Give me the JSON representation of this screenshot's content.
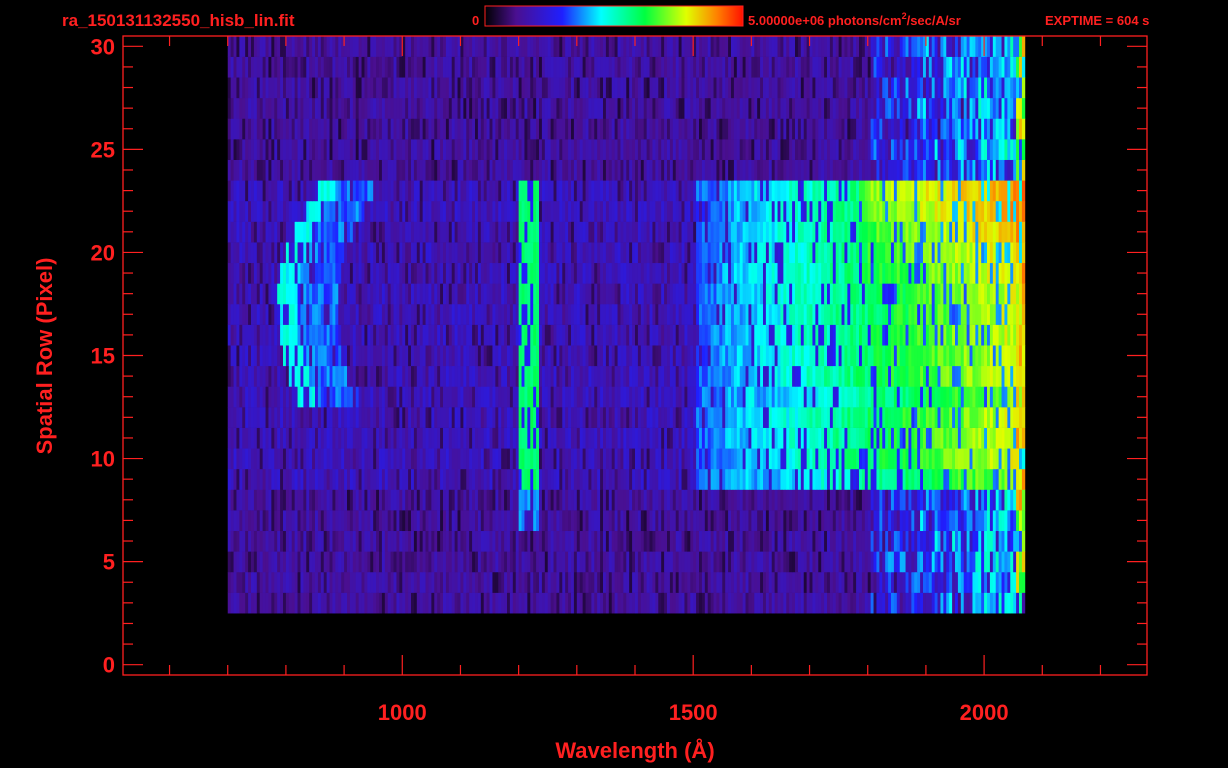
{
  "header": {
    "filename": "ra_150131132550_hisb_lin.fit",
    "colorbar_min_label": "0",
    "colorbar_max_label": "5.00000e+06 photons/cm",
    "colorbar_unit_exp": "2",
    "colorbar_unit_tail": "/sec/A/sr",
    "exptime": "EXPTIME = 604 s"
  },
  "colors": {
    "axis": "#ff2020",
    "background": "#000000",
    "colormap": [
      "#000000",
      "#3a0a6a",
      "#5a18b0",
      "#1f1fff",
      "#0090ff",
      "#00ffff",
      "#00ff7f",
      "#40ff00",
      "#c8ff00",
      "#ffd000",
      "#ff7000",
      "#ff0000"
    ]
  },
  "chart_data": {
    "type": "heatmap",
    "title": "",
    "xlabel": "Wavelength (Å)",
    "ylabel": "Spatial Row (Pixel)",
    "xlim": [
      520,
      2280
    ],
    "ylim": [
      -0.5,
      30.5
    ],
    "xticks": [
      1000,
      1500,
      2000
    ],
    "xtick_labels": [
      "1000",
      "1500",
      "2000"
    ],
    "yticks": [
      0,
      5,
      10,
      15,
      20,
      25,
      30
    ],
    "ytick_labels": [
      "0",
      "5",
      "10",
      "15",
      "20",
      "25",
      "30"
    ],
    "colorbar": {
      "min": 0,
      "max": 5000000,
      "unit": "photons/cm2/sec/A/sr"
    },
    "rows": {
      "first": 0,
      "last": 30
    },
    "wavelength_coverage": [
      700,
      2065
    ],
    "bright_slit_rows": [
      9,
      23
    ],
    "features": [
      {
        "label": "Lyman-alpha line",
        "wavelength": 1216,
        "rows": [
          7,
          23
        ],
        "level": 0.55
      },
      {
        "label": "curved arc",
        "wavelength": [
          795,
          880
        ],
        "rows": [
          13,
          23
        ],
        "level": 0.45
      },
      {
        "label": "continuum",
        "wavelength": [
          1600,
          2060
        ],
        "rows": [
          9,
          23
        ],
        "level": 0.75
      }
    ],
    "grid": false,
    "legend": "none"
  }
}
